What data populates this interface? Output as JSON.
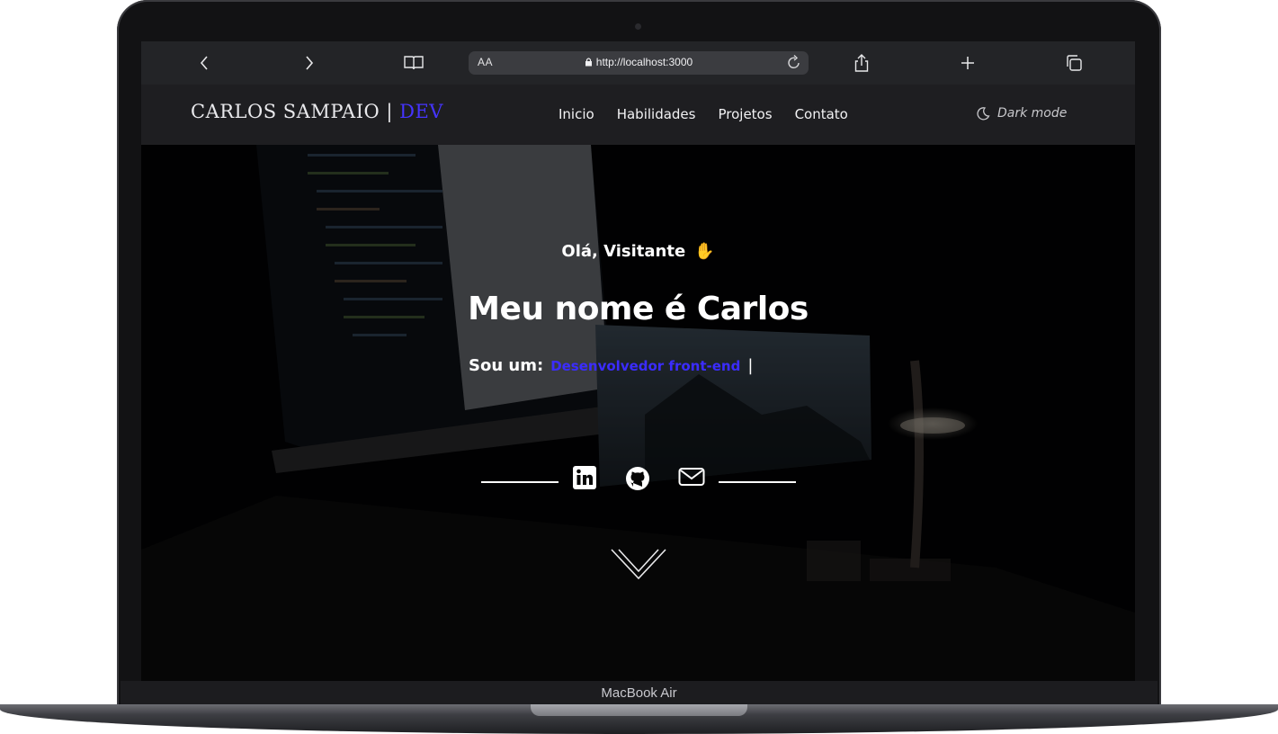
{
  "device": {
    "label": "MacBook Air"
  },
  "browser": {
    "text_size_label": "AA",
    "url": "http://localhost:3000",
    "icons": [
      "chevron-left-icon",
      "chevron-right-icon",
      "book-icon",
      "lock-icon",
      "reload-icon",
      "share-icon",
      "plus-icon",
      "tabs-icon"
    ]
  },
  "site": {
    "brand": {
      "name": "CARLOS SAMPAIO | ",
      "accent": "DEV"
    },
    "nav": [
      {
        "label": "Inicio"
      },
      {
        "label": "Habilidades"
      },
      {
        "label": "Projetos"
      },
      {
        "label": "Contato"
      }
    ],
    "theme_toggle": {
      "label": "Dark mode",
      "icon": "moon-icon"
    },
    "colors": {
      "accent": "#4534ff",
      "nav_bg": "#1e1e21",
      "toolbar_bg": "#232427"
    }
  },
  "hero": {
    "greeting": "Olá, Visitante",
    "greeting_emoji": "✋",
    "headline": "Meu nome é Carlos",
    "role_prefix": "Sou um:",
    "role_value": "Desenvolvedor front-end",
    "cursor": "|",
    "social": [
      "linkedin-icon",
      "github-icon",
      "mail-icon"
    ],
    "scroll_icon": "double-chevron-down-icon"
  }
}
